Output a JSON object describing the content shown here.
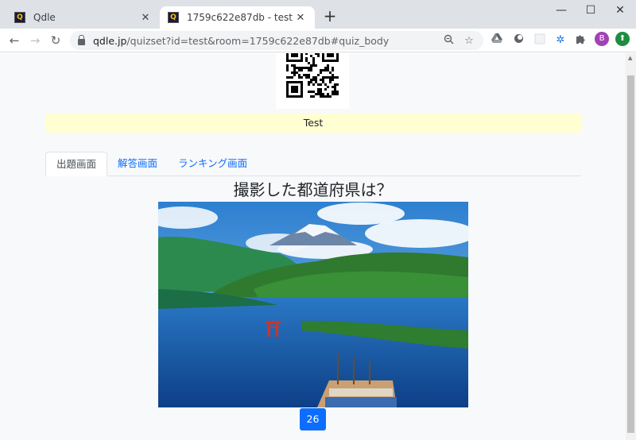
{
  "browser": {
    "tabs": [
      {
        "title": "Qdle",
        "favicon": "Q"
      },
      {
        "title": "1759c622e87db - test",
        "favicon": "Q"
      }
    ],
    "url_host": "qdle.jp",
    "url_path": "/quizset?id=test&room=1759c622e87db#quiz_body",
    "profile_initial": "B",
    "window_controls": {
      "minimize": "—",
      "maximize": "☐",
      "close": "✕"
    },
    "new_tab_icon": "+"
  },
  "page": {
    "banner_text": "Test",
    "tabs": [
      {
        "label": "出題画面",
        "active": true
      },
      {
        "label": "解答画面",
        "active": false
      },
      {
        "label": "ランキング画面",
        "active": false
      }
    ],
    "question": "撮影した都道府県は？",
    "timer": "26"
  },
  "colors": {
    "accent": "#0d6efd",
    "banner_bg": "#ffffd2",
    "profile": "#a142b4"
  }
}
